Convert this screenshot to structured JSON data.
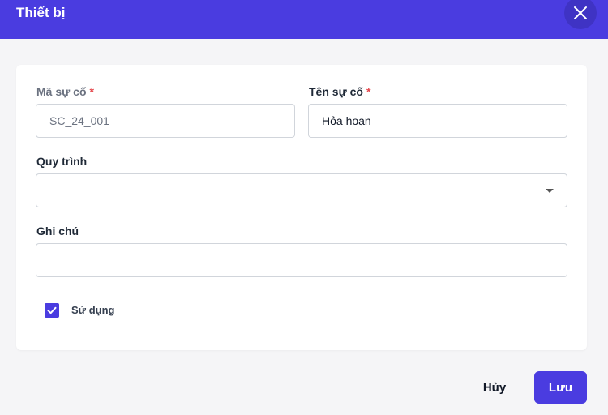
{
  "dialog": {
    "title": "Thiết bị",
    "close_icon": "close-icon"
  },
  "form": {
    "code": {
      "label": "Mã sự cố",
      "required_mark": "*",
      "value": "SC_24_001"
    },
    "name": {
      "label": "Tên sự cố",
      "required_mark": "*",
      "value": "Hỏa hoạn"
    },
    "process": {
      "label": "Quy trình",
      "value": "",
      "dropdown_icon": "chevron-down-icon"
    },
    "note": {
      "label": "Ghi chú",
      "value": ""
    },
    "in_use": {
      "label": "Sử dụng",
      "checked": true
    }
  },
  "footer": {
    "cancel_label": "Hủy",
    "save_label": "Lưu"
  },
  "colors": {
    "accent": "#4a3ce0",
    "required": "#e5484d"
  }
}
